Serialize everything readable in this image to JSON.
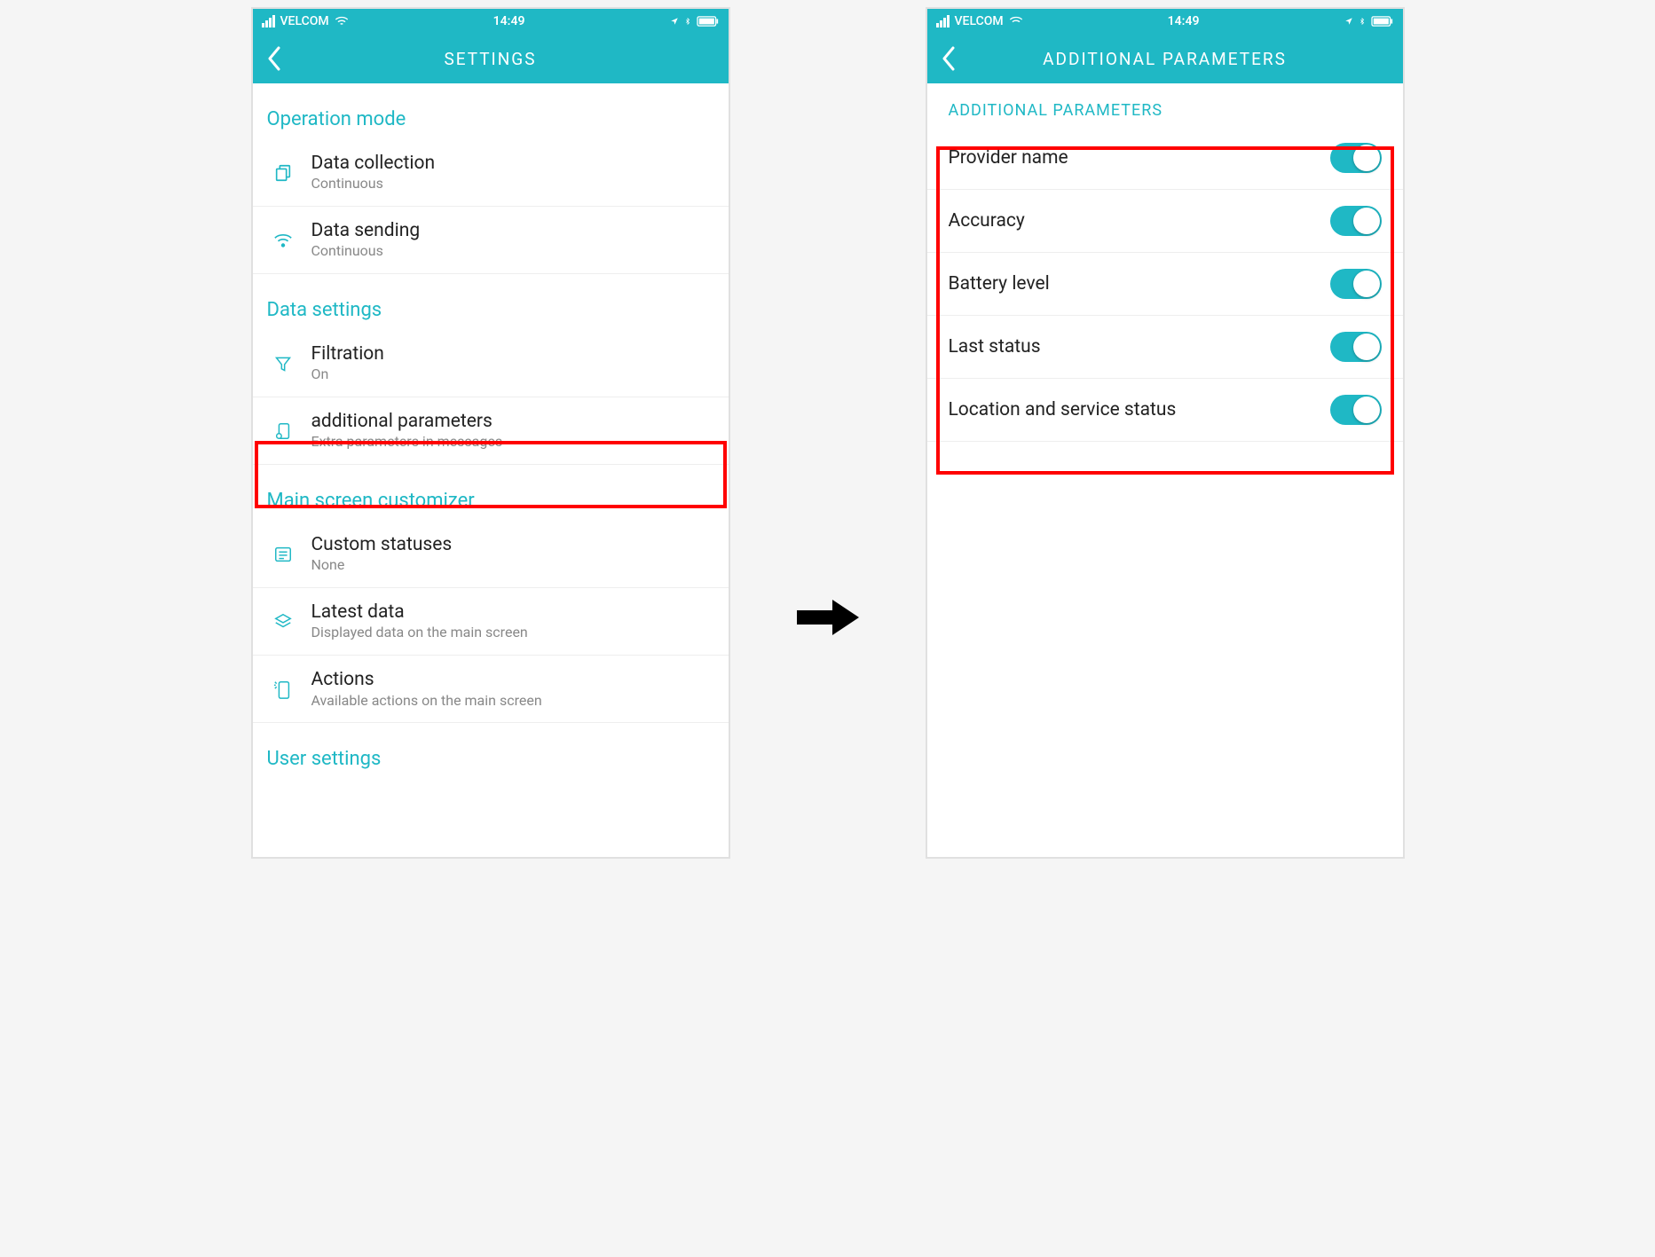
{
  "status_bar": {
    "carrier": "VELCOM",
    "time": "14:49"
  },
  "left": {
    "title": "SETTINGS",
    "sections": {
      "operation_mode": {
        "header": "Operation mode",
        "items": [
          {
            "title": "Data collection",
            "sub": "Continuous"
          },
          {
            "title": "Data sending",
            "sub": "Continuous"
          }
        ]
      },
      "data_settings": {
        "header": "Data settings",
        "items": [
          {
            "title": "Filtration",
            "sub": "On"
          },
          {
            "title": "additional parameters",
            "sub": "Extra parameters in messages"
          }
        ]
      },
      "main_screen": {
        "header": "Main screen customizer",
        "items": [
          {
            "title": "Custom statuses",
            "sub": "None"
          },
          {
            "title": "Latest data",
            "sub": "Displayed data on the main screen"
          },
          {
            "title": "Actions",
            "sub": "Available actions on the main screen"
          }
        ]
      },
      "user_settings": {
        "header": "User settings"
      }
    }
  },
  "right": {
    "title": "ADDITIONAL PARAMETERS",
    "section_header": "ADDITIONAL PARAMETERS",
    "toggles": [
      {
        "label": "Provider name",
        "on": true
      },
      {
        "label": "Accuracy",
        "on": true
      },
      {
        "label": "Battery level",
        "on": true
      },
      {
        "label": "Last status",
        "on": true
      },
      {
        "label": "Location and service status",
        "on": true
      }
    ]
  }
}
